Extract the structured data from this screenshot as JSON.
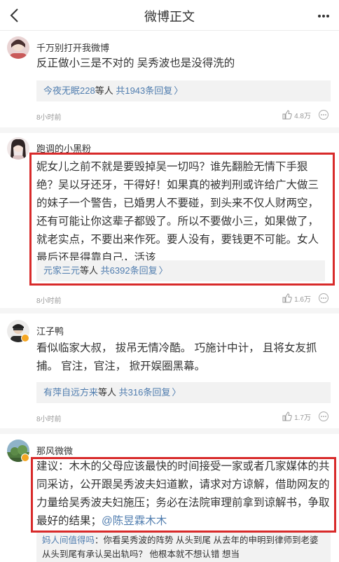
{
  "nav": {
    "title": "微博正文"
  },
  "comments": [
    {
      "username": "千万别打开我微博",
      "text": "反正做小三是不对的 吴秀波也是没得洗的",
      "reply_user": "今夜无眠228",
      "reply_mid": "等人",
      "reply_count": "共1943条回复",
      "time": "8小时前",
      "likes": "4.8万"
    },
    {
      "username": "跑调的小黑粉",
      "text": "妮女儿之前不就是要毁掉吴一切吗？谁先翻脸无情下手狠绝？吴以牙还牙，干得好！如果真的被判刑或许给广大做三的妹子一个警告，已婚男人不要碰，到头来不仅人财两空，还有可能让你这辈子都毁了。所以不要做小三，如果做了，就老实点，不要出来作死。要人没有，要钱更不可能。女人最后还是得靠自己，活该",
      "reply_user": "元家三元",
      "reply_mid": "等人",
      "reply_count": "共6392条回复",
      "time": "8小时前",
      "likes": "1.6万"
    },
    {
      "username": "江子鸭",
      "text": "看似临家大叔， 拔吊无情冷酷。 巧施计中计， 且将女友抓捕。 官注，官注， 掀开娱圈黑幕。",
      "reply_user": "有萍自远方来",
      "reply_mid": "等人",
      "reply_count": "共316条回复",
      "time": "8小时前",
      "likes": "1.7万"
    },
    {
      "username": "那风微微",
      "text": "建议：木木的父母应该最快的时间接受一家或者几家媒体的共同采访，公开跟吴秀波夫妇道歉，请求对方谅解，借助网友的力量给吴秀波夫妇施压；务必在法院审理前拿到谅解书，争取最好的结果；",
      "mention": "@陈昱霖木木",
      "subreply_author": "妈人间值得吗",
      "subreply_text": "：你看吴秀波的阵势 从头到尾 从去年的申明到律师到老婆 从头到尾有承认吴出轨吗？ 他根本就不想认错 想当"
    }
  ]
}
